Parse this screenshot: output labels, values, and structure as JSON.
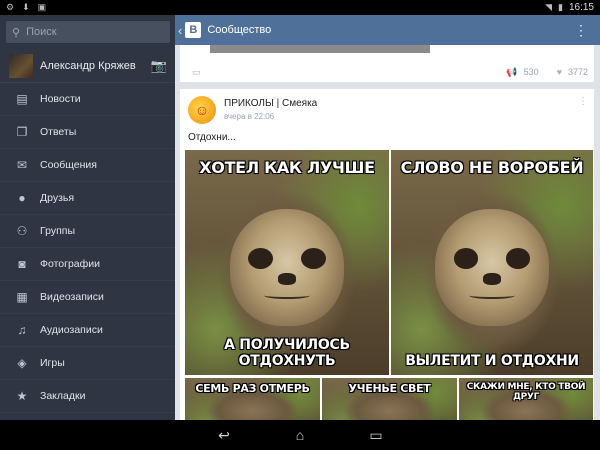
{
  "statusbar": {
    "time": "16:15"
  },
  "sidebar": {
    "search_placeholder": "Поиск",
    "profile_name": "Александр Кряжев",
    "items": [
      {
        "label": "Новости",
        "icon": "news-icon"
      },
      {
        "label": "Ответы",
        "icon": "replies-icon"
      },
      {
        "label": "Сообщения",
        "icon": "messages-icon"
      },
      {
        "label": "Друзья",
        "icon": "friends-icon"
      },
      {
        "label": "Группы",
        "icon": "groups-icon"
      },
      {
        "label": "Фотографии",
        "icon": "photos-icon"
      },
      {
        "label": "Видеозаписи",
        "icon": "video-icon"
      },
      {
        "label": "Аудиозаписи",
        "icon": "audio-icon"
      },
      {
        "label": "Игры",
        "icon": "games-icon"
      },
      {
        "label": "Закладки",
        "icon": "bookmarks-icon"
      }
    ]
  },
  "header": {
    "logo": "В",
    "title": "Сообщество"
  },
  "prev_post": {
    "reposts": "530",
    "likes": "3772"
  },
  "post": {
    "group_name": "ПРИКОЛЫ | Смеяка",
    "time": "вчера в 22:06",
    "text": "Отдохни...",
    "memes": [
      {
        "top": "ХОТЕЛ КАК ЛУЧШЕ",
        "bottom": "А ПОЛУЧИЛОСЬ ОТДОХНУТЬ"
      },
      {
        "top": "СЛОВО НЕ ВОРОБЕЙ",
        "bottom": "ВЫЛЕТИТ И ОТДОХНИ"
      },
      {
        "top": "СЕМЬ РАЗ ОТМЕРЬ"
      },
      {
        "top": "УЧЕНЬЕ СВЕТ"
      },
      {
        "top": "СКАЖИ МНЕ, КТО ТВОЙ ДРУГ"
      }
    ]
  }
}
